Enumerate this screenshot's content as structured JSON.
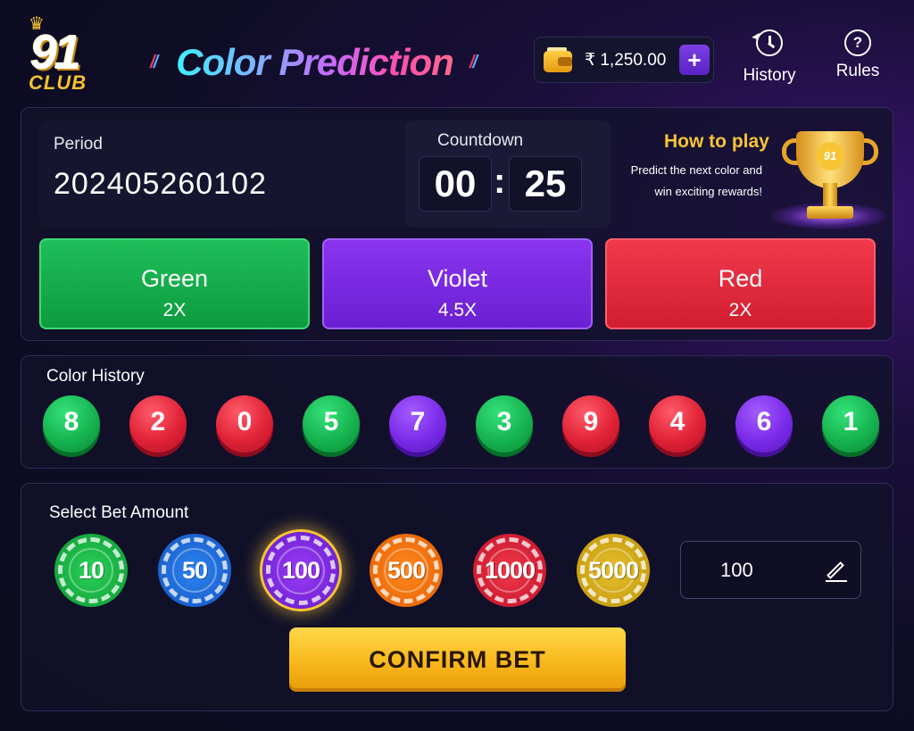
{
  "header": {
    "logo_number": "91",
    "logo_text": "CLUB",
    "title": "Color Prediction",
    "wallet": {
      "balance": "₹ 1,250.00",
      "add_label": "+"
    },
    "nav": {
      "history_label": "History",
      "rules_label": "Rules",
      "rules_glyph": "?"
    }
  },
  "game": {
    "period_label": "Period",
    "period_value": "202405260102",
    "countdown_label": "Countdown",
    "countdown_minutes": "00",
    "countdown_seconds": "25",
    "countdown_separator": ":",
    "how_to_play_title": "How to play",
    "how_to_play_line1": "Predict the next color and",
    "how_to_play_line2": "win exciting rewards!",
    "trophy_emblem": "91",
    "colors": [
      {
        "name": "Green",
        "multiplier": "2X",
        "color": "#16b34f"
      },
      {
        "name": "Violet",
        "multiplier": "4.5X",
        "color": "#7a2be8"
      },
      {
        "name": "Red",
        "multiplier": "2X",
        "color": "#e02236"
      }
    ]
  },
  "history": {
    "title": "Color History",
    "results": [
      {
        "number": "8",
        "color": "green"
      },
      {
        "number": "2",
        "color": "red"
      },
      {
        "number": "0",
        "color": "red"
      },
      {
        "number": "5",
        "color": "green"
      },
      {
        "number": "7",
        "color": "violet"
      },
      {
        "number": "3",
        "color": "green"
      },
      {
        "number": "9",
        "color": "red"
      },
      {
        "number": "4",
        "color": "red"
      },
      {
        "number": "6",
        "color": "violet"
      },
      {
        "number": "1",
        "color": "green"
      }
    ]
  },
  "bet": {
    "title": "Select Bet Amount",
    "chips": [
      "10",
      "50",
      "100",
      "500",
      "1000",
      "5000"
    ],
    "selected_chip": "100",
    "amount_value": "100",
    "confirm_label": "CONFIRM BET"
  },
  "colors": {
    "accent_gold": "#f7c436",
    "panel_border": "#2f2d55",
    "background": "#0f0d26"
  }
}
